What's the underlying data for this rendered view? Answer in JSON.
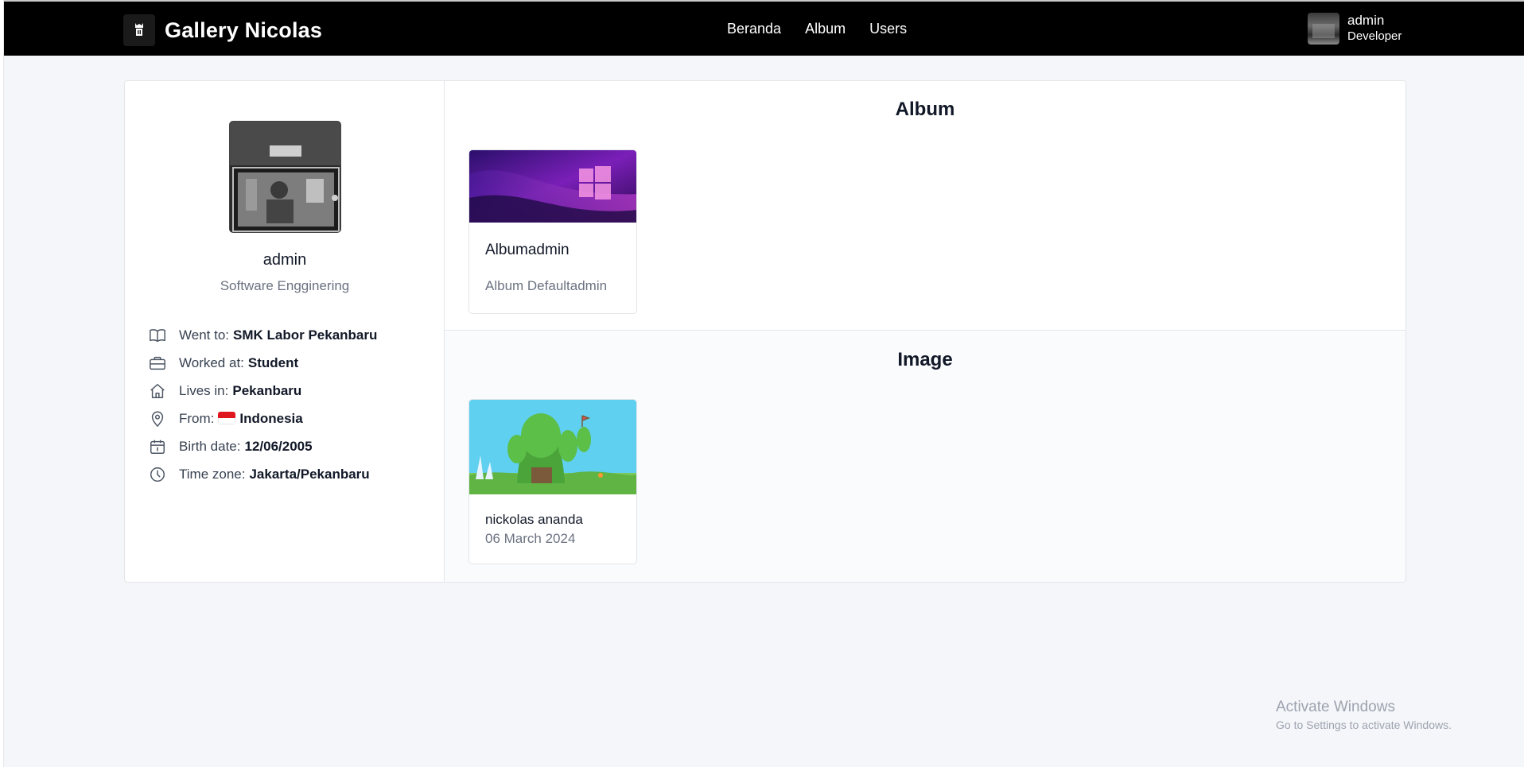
{
  "navbar": {
    "brand_title": "Gallery Nicolas",
    "links": [
      {
        "label": "Beranda"
      },
      {
        "label": "Album"
      },
      {
        "label": "Users"
      }
    ],
    "user": {
      "name": "admin",
      "role": "Developer"
    }
  },
  "profile": {
    "name": "admin",
    "subtitle": "Software Engginering",
    "info": [
      {
        "icon": "book-icon",
        "label": "Went to:",
        "value": "SMK Labor Pekanbaru"
      },
      {
        "icon": "briefcase-icon",
        "label": "Worked at:",
        "value": "Student"
      },
      {
        "icon": "home-icon",
        "label": "Lives in:",
        "value": "Pekanbaru"
      },
      {
        "icon": "location-pin-icon",
        "label": "From:",
        "value": "Indonesia"
      },
      {
        "icon": "calendar-icon",
        "label": "Birth date:",
        "value": "12/06/2005"
      },
      {
        "icon": "clock-icon",
        "label": "Time zone:",
        "value": "Jakarta/Pekanbaru"
      }
    ]
  },
  "album_section": {
    "title": "Album",
    "albums": [
      {
        "title": "Albumadmin",
        "description": "Album Defaultadmin"
      }
    ]
  },
  "image_section": {
    "title": "Image",
    "images": [
      {
        "author": "nickolas ananda",
        "date": "06 March 2024"
      }
    ]
  },
  "watermark": {
    "title": "Activate Windows",
    "subtitle": "Go to Settings to activate Windows."
  },
  "colors": {
    "navbar_bg": "#000000",
    "page_bg": "#f5f6f9",
    "text_muted": "#6b7280"
  }
}
